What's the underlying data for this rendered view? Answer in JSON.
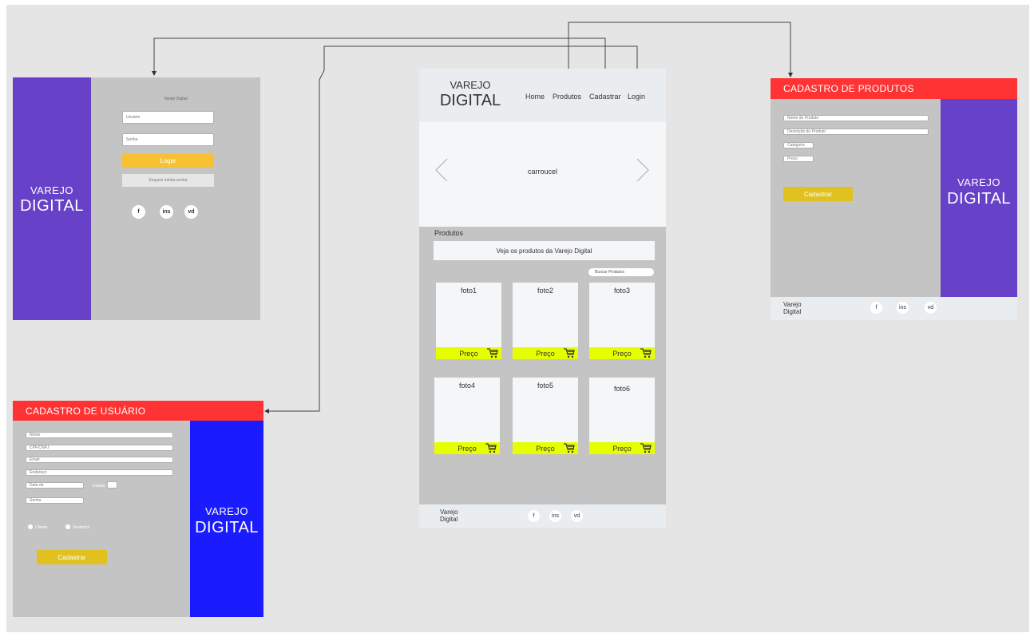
{
  "login_screen": {
    "brand_small": "VAREJO",
    "brand_large": "DIGITAL",
    "heading": "Varejo Digital",
    "user_placeholder": "Usuário",
    "password_placeholder": "Senha",
    "login_button": "Logar",
    "forgot_button": "Esqueci minha senha",
    "social": [
      "f",
      "ins",
      "vd"
    ]
  },
  "user_signup": {
    "title": "CADASTRO DE USUÁRIO",
    "fields": [
      "Nome",
      "CPF/CNPJ",
      "Email",
      "Endereço"
    ],
    "date_label": "Data de",
    "status_label": "Estado",
    "password_placeholder": "Senha",
    "radio_options": [
      "Cliente",
      "Vendedor"
    ],
    "submit_button": "Cadastrar",
    "brand_small": "VAREJO",
    "brand_large": "DIGITAL"
  },
  "home_screen": {
    "brand_small": "VAREJO",
    "brand_large": "DIGITAL",
    "nav": [
      "Home",
      "Produtos",
      "Cadastrar",
      "Login"
    ],
    "carousel_label": "carroucel",
    "products_heading": "Produtos",
    "products_banner": "Veja os produtos da Varejo Digital",
    "search_placeholder": "Buscar Produtos",
    "products": [
      {
        "name": "foto1",
        "price": "Preço"
      },
      {
        "name": "foto2",
        "price": "Preço"
      },
      {
        "name": "foto3",
        "price": "Preço"
      },
      {
        "name": "foto4",
        "price": "Preço"
      },
      {
        "name": "foto5",
        "price": "Preço"
      },
      {
        "name": "foto6",
        "price": "Preço"
      }
    ],
    "footer_brand_line1": "Varejo",
    "footer_brand_line2": "Digital",
    "social": [
      "f",
      "ins",
      "vd"
    ]
  },
  "product_signup": {
    "title": "CADASTRO DE PRODUTOS",
    "fields": [
      "Nome do Produto",
      "Descrição do Produto",
      "Categoria",
      "Preço"
    ],
    "submit_button": "Cadastrar",
    "brand_small": "VAREJO",
    "brand_large": "DIGITAL",
    "footer_brand_line1": "Varejo",
    "footer_brand_line2": "Digital",
    "social": [
      "f",
      "ins",
      "vd"
    ]
  },
  "colors": {
    "canvas": "#e5e5e5",
    "purple": "#6741c8",
    "blue": "#1a1cff",
    "red": "#ff3333",
    "yellow": "#f6c132",
    "gold": "#e0c120",
    "lime": "#e6ff00",
    "panel_gray": "#c4c4c4"
  }
}
